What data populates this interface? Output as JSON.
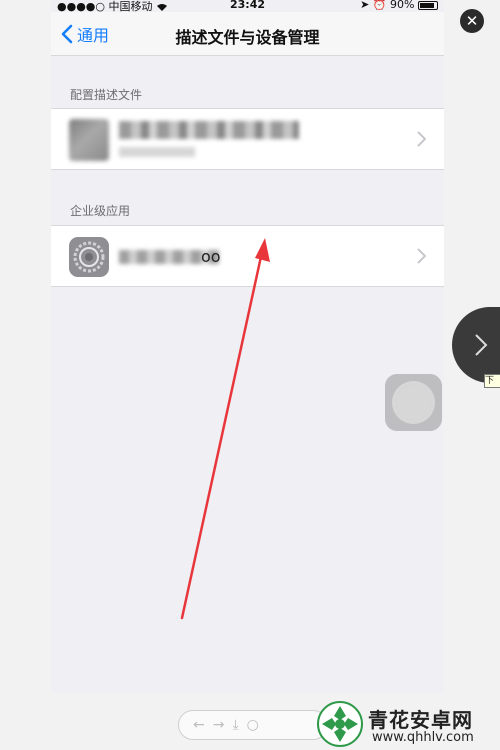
{
  "status_bar": {
    "carrier": "●●●●○ 中国移动",
    "time": "23:42",
    "battery": "90%"
  },
  "nav": {
    "back_label": "通用",
    "title": "描述文件与设备管理"
  },
  "sections": [
    {
      "header": "配置描述文件"
    },
    {
      "header": "企业级应用",
      "item_suffix": "oo"
    }
  ],
  "watermark": {
    "name": "青花安卓网",
    "url": "www.qhhlv.com"
  },
  "tooltip": "下一",
  "icons": {
    "back": "chevron-left-icon",
    "close": "close-icon",
    "next": "chevron-right-icon",
    "settings": "settings-gear-icon",
    "wifi": "wifi-icon"
  },
  "colors": {
    "accent": "#147efb",
    "annotation_arrow": "#e8363b"
  }
}
